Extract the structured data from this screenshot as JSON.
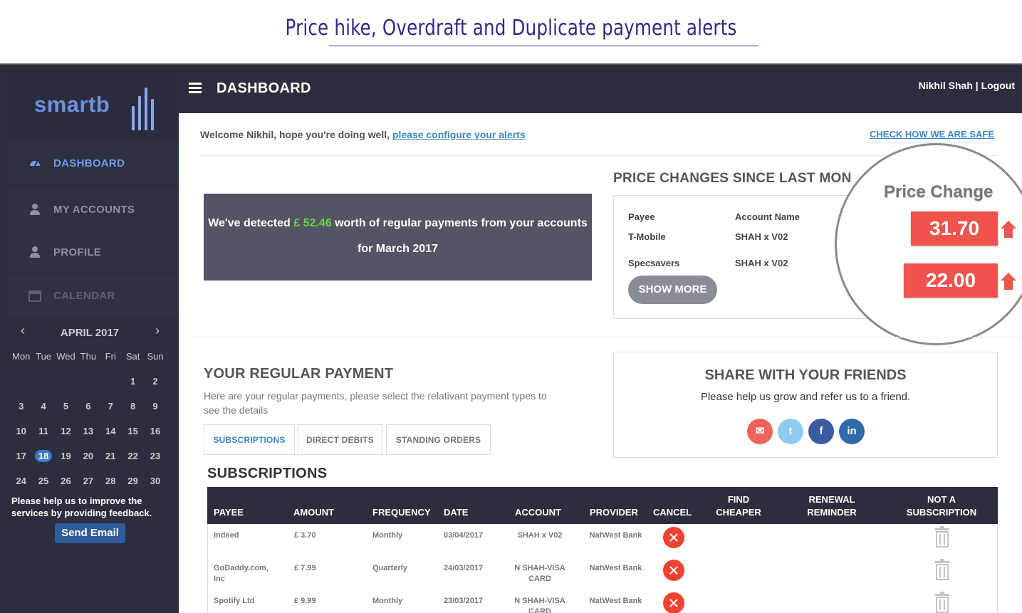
{
  "banner": {
    "title": "Price hike, Overdraft and Duplicate payment alerts"
  },
  "app": {
    "logo_text": "smartb"
  },
  "sidebar": {
    "items": [
      {
        "label": "DASHBOARD",
        "icon": "dashboard-icon"
      },
      {
        "label": "MY ACCOUNTS",
        "icon": "user-icon"
      },
      {
        "label": "PROFILE",
        "icon": "user-icon"
      },
      {
        "label": "CALENDAR",
        "icon": "calendar-icon"
      }
    ]
  },
  "calendar": {
    "month": "APRIL 2017",
    "prev": "‹",
    "next": "›",
    "weekdays": [
      "Mon",
      "Tue",
      "Wed",
      "Thu",
      "Fri",
      "Sat",
      "Sun"
    ],
    "weeks": [
      [
        "",
        "",
        "",
        "",
        "",
        "1",
        "2"
      ],
      [
        "3",
        "4",
        "5",
        "6",
        "7",
        "8",
        "9"
      ],
      [
        "10",
        "11",
        "12",
        "13",
        "14",
        "15",
        "16"
      ],
      [
        "17",
        "18",
        "19",
        "20",
        "21",
        "22",
        "23"
      ],
      [
        "24",
        "25",
        "26",
        "27",
        "28",
        "29",
        "30"
      ]
    ],
    "today": "18"
  },
  "feedback": {
    "text": "Please help us to improve the services by providing feedback.",
    "button": "Send Email"
  },
  "topbar": {
    "title": "DASHBOARD",
    "user": "Nikhil Shah",
    "separator": "|",
    "logout": "Logout"
  },
  "welcome": {
    "text": "Welcome Nikhil, hope you're doing well,",
    "link": "please configure your alerts",
    "safe_link": "CHECK HOW WE ARE SAFE"
  },
  "detected": {
    "prefix": "We've detected",
    "amount": "£ 52.46",
    "suffix": "worth of regular payments from your accounts for March 2017"
  },
  "price_changes": {
    "title": "PRICE CHANGES SINCE LAST MON",
    "header_payee": "Payee",
    "header_account": "Account Name",
    "rows": [
      {
        "payee": "T-Mobile",
        "account": "SHAH x V02"
      },
      {
        "payee": "Specsavers",
        "account": "SHAH x V02"
      }
    ],
    "show_more": "SHOW MORE"
  },
  "magnifier": {
    "title": "Price Change",
    "values": [
      "31.70",
      "22.00"
    ],
    "accent": "#f0544c"
  },
  "regular": {
    "title": "YOUR REGULAR PAYMENT",
    "desc": "Here are your regular payments, please select the relativant payment types to see the details",
    "tabs": [
      "SUBSCRIPTIONS",
      "DIRECT DEBITS",
      "STANDING ORDERS"
    ]
  },
  "share": {
    "title": "SHARE WITH YOUR FRIENDS",
    "subtitle": "Please help us grow and refer us to a friend.",
    "icons": [
      {
        "name": "email-icon",
        "glyph": "✉",
        "color": "#f0625c"
      },
      {
        "name": "twitter-icon",
        "glyph": "t",
        "color": "#8ecbf0"
      },
      {
        "name": "facebook-icon",
        "glyph": "f",
        "color": "#3b5ba0"
      },
      {
        "name": "linkedin-icon",
        "glyph": "in",
        "color": "#2f6aab"
      }
    ]
  },
  "subscriptions": {
    "title": "SUBSCRIPTIONS",
    "headers": [
      "PAYEE",
      "AMOUNT",
      "FREQUENCY",
      "DATE",
      "ACCOUNT",
      "PROVIDER",
      "CANCEL",
      "FIND CHEAPER",
      "RENEWAL REMINDER",
      "NOT A SUBSCRIPTION"
    ],
    "rows": [
      {
        "payee": "Indeed",
        "amount": "£ 3.70",
        "frequency": "Monthly",
        "date": "03/04/2017",
        "account": "SHAH x V02",
        "provider": "NatWest Bank"
      },
      {
        "payee": "GoDaddy.com, Inc",
        "amount": "£ 7.99",
        "frequency": "Quarterly",
        "date": "24/03/2017",
        "account": "N SHAH-VISA CARD",
        "provider": "NatWest Bank"
      },
      {
        "payee": "Spotify Ltd",
        "amount": "£ 9.99",
        "frequency": "Monthly",
        "date": "23/03/2017",
        "account": "N SHAH-VISA CARD",
        "provider": "NatWest Bank"
      }
    ]
  }
}
